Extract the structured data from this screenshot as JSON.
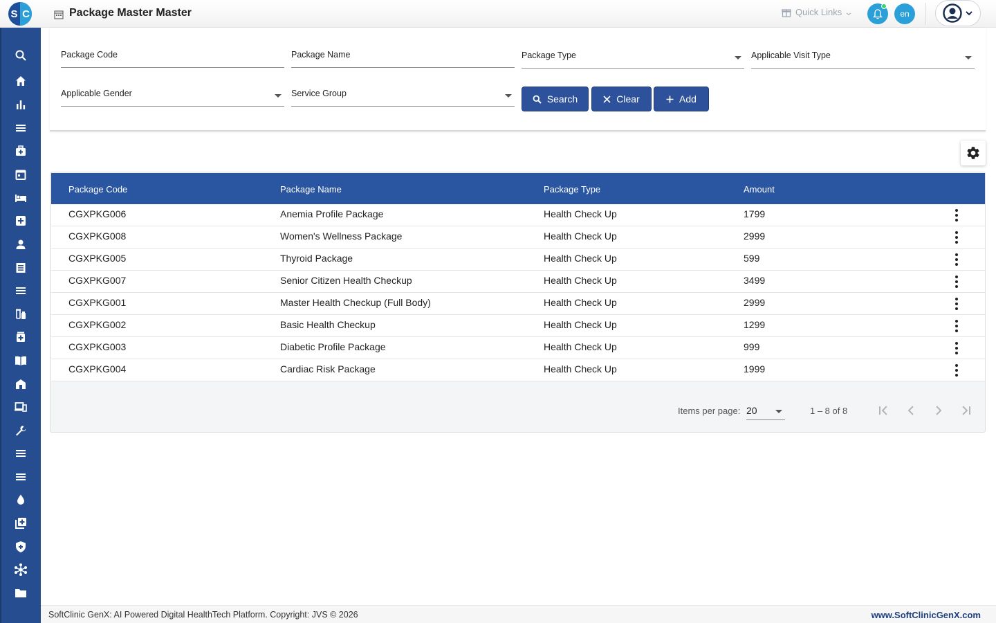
{
  "header": {
    "logo_s": "S",
    "logo_c": "C",
    "title": "Package Master Master",
    "quick_links": "Quick Links",
    "lang": "en"
  },
  "sidebar": {
    "icons": [
      "search-icon",
      "home-icon",
      "bar-chart-icon",
      "menu-icon",
      "medical-bag-icon",
      "calendar-icon",
      "bed-icon",
      "plus-box-icon",
      "person-icon",
      "receipt-icon",
      "list-icon",
      "vaccine-icon",
      "medicine-icon",
      "book-icon",
      "building-icon",
      "devices-icon",
      "wrench-icon",
      "lines-icon",
      "lines-icon-2",
      "drop-icon",
      "add-library-icon",
      "shield-icon",
      "hub-icon",
      "folder-icon"
    ]
  },
  "filters": {
    "package_code": "Package Code",
    "package_name": "Package Name",
    "package_type": "Package Type",
    "visit_type": "Applicable Visit Type",
    "gender": "Applicable Gender",
    "service_group": "Service Group",
    "search_label": "Search",
    "clear_label": "Clear",
    "add_label": "Add"
  },
  "table": {
    "headers": [
      "Package Code",
      "Package Name",
      "Package Type",
      "Amount"
    ],
    "rows": [
      {
        "code": "CGXPKG006",
        "name": "Anemia Profile Package",
        "type": "Health Check Up",
        "amount": "1799"
      },
      {
        "code": "CGXPKG008",
        "name": "Women's Wellness Package",
        "type": "Health Check Up",
        "amount": "2999"
      },
      {
        "code": "CGXPKG005",
        "name": "Thyroid Package",
        "type": "Health Check Up",
        "amount": "599"
      },
      {
        "code": "CGXPKG007",
        "name": "Senior Citizen Health Checkup",
        "type": "Health Check Up",
        "amount": "3499"
      },
      {
        "code": "CGXPKG001",
        "name": "Master Health Checkup (Full Body)",
        "type": "Health Check Up",
        "amount": "2999"
      },
      {
        "code": "CGXPKG002",
        "name": "Basic Health Checkup",
        "type": "Health Check Up",
        "amount": "1299"
      },
      {
        "code": "CGXPKG003",
        "name": "Diabetic Profile Package",
        "type": "Health Check Up",
        "amount": "999"
      },
      {
        "code": "CGXPKG004",
        "name": "Cardiac Risk Package",
        "type": "Health Check Up",
        "amount": "1999"
      }
    ]
  },
  "paginator": {
    "items_per_page_label": "Items per page:",
    "items_per_page": "20",
    "range": "1 – 8 of 8"
  },
  "footer": {
    "copyright": "SoftClinic GenX: AI Powered Digital HealthTech Platform. Copyright: JVS © 2026",
    "website": "www.SoftClinicGenX.com"
  },
  "colors": {
    "primary": "#2d529b",
    "sidebar": "#264d8f",
    "accent": "#2a9fd8"
  }
}
